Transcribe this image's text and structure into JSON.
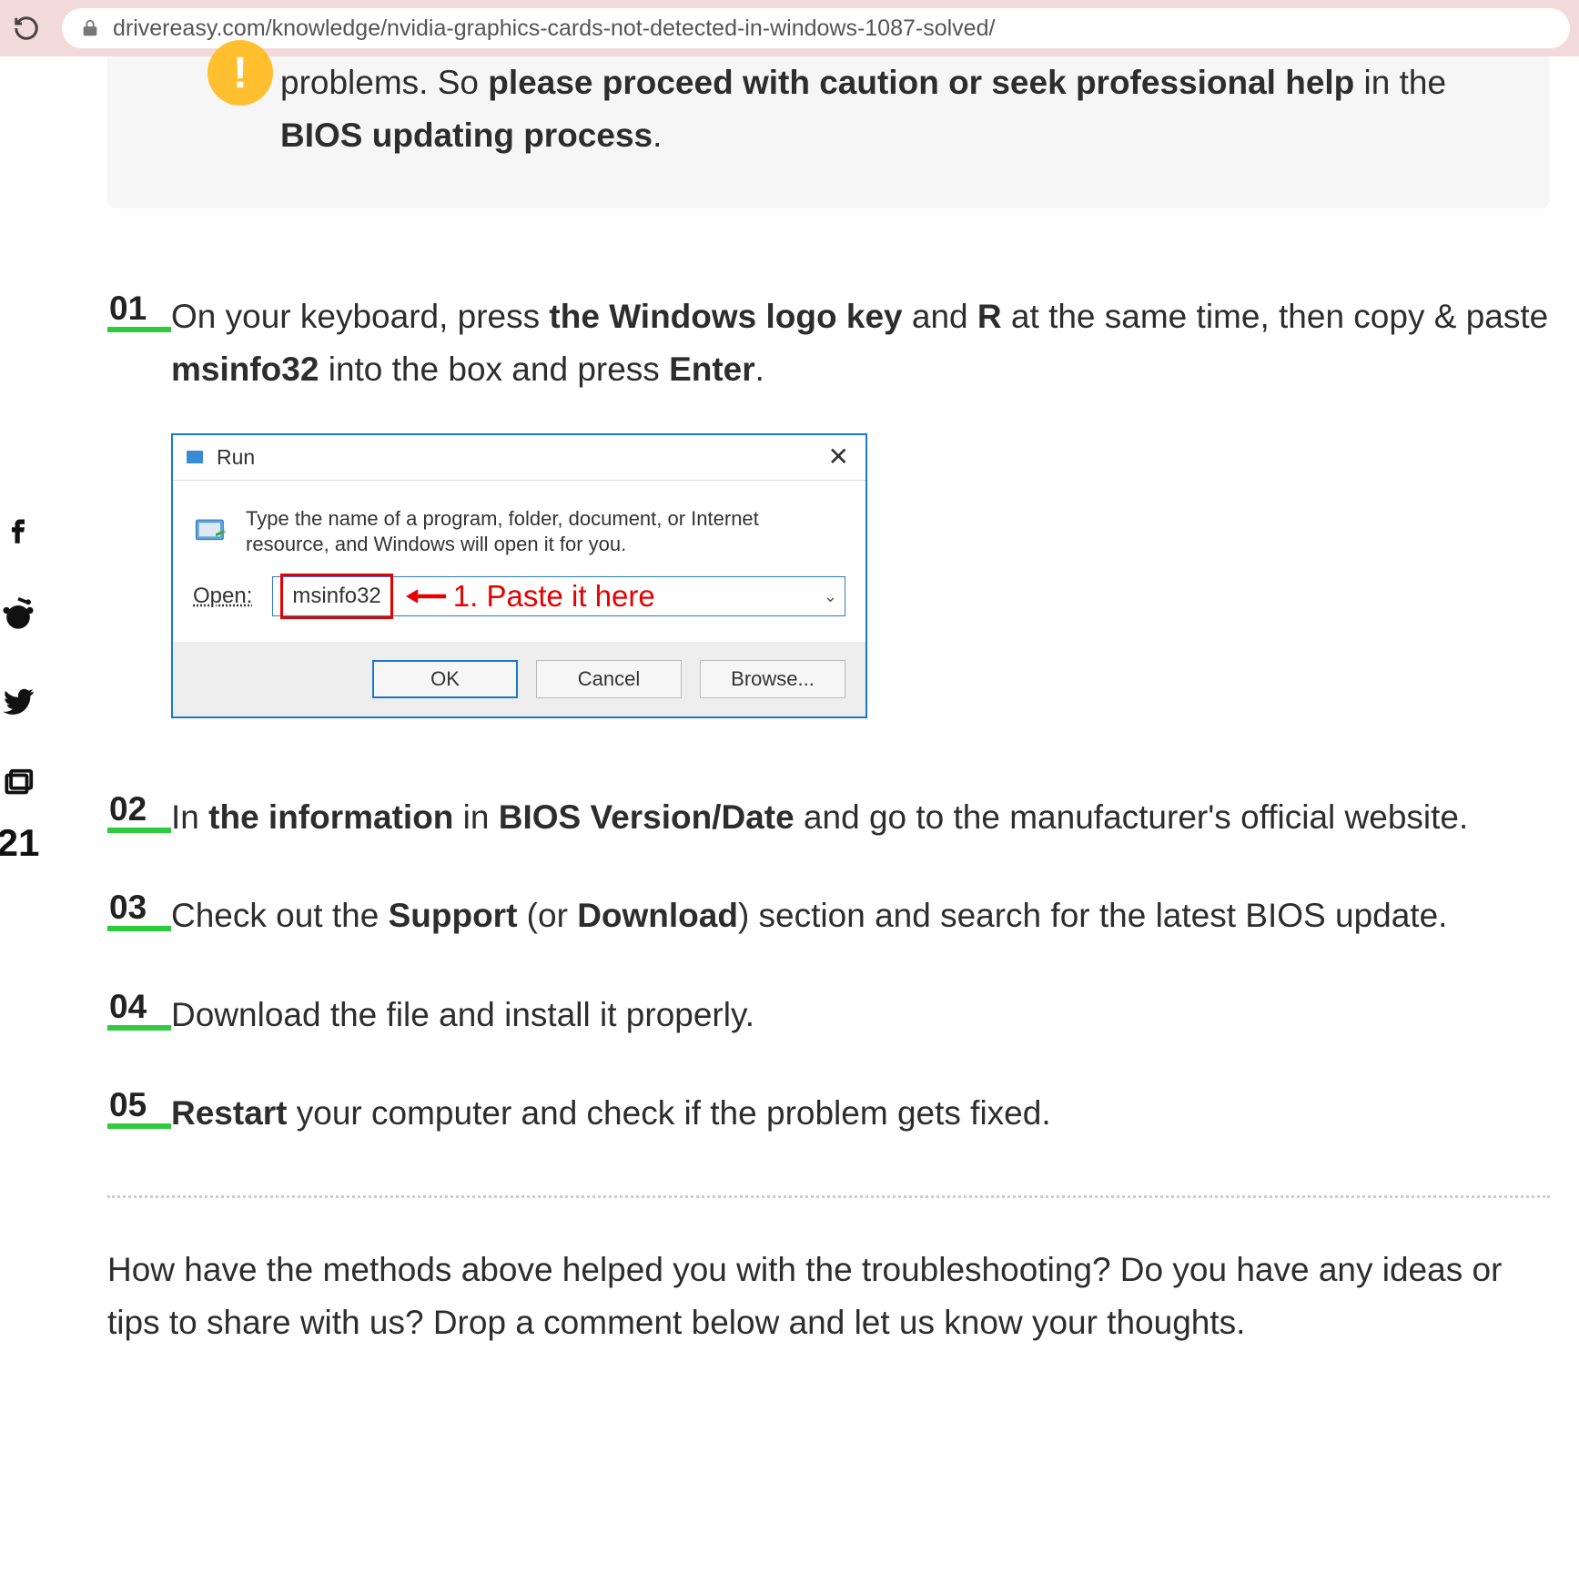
{
  "page_url": "drivereasy.com/knowledge/nvidia-graphics-cards-not-detected-in-windows-1087-solved/",
  "warning": {
    "pre": "problems. So ",
    "bold1": "please proceed with caution or seek professional help",
    "mid": " in the ",
    "bold2": "BIOS updating process",
    "post": "."
  },
  "steps": [
    {
      "num": "01",
      "parts": [
        {
          "t": "On your keyboard, press "
        },
        {
          "t": "the Windows logo key",
          "b": true
        },
        {
          "t": " and "
        },
        {
          "t": "R",
          "b": true
        },
        {
          "t": " at the same time, then copy & paste "
        },
        {
          "t": "msinfo32",
          "b": true
        },
        {
          "t": " into the box and press "
        },
        {
          "t": "Enter",
          "b": true
        },
        {
          "t": "."
        }
      ]
    },
    {
      "num": "02",
      "parts": [
        {
          "t": "In "
        },
        {
          "t": "the information",
          "b": true
        },
        {
          "t": " in "
        },
        {
          "t": "BIOS Version/Date",
          "b": true
        },
        {
          "t": " and go to the manufacturer's official website."
        }
      ]
    },
    {
      "num": "03",
      "parts": [
        {
          "t": "Check out the "
        },
        {
          "t": "Support",
          "b": true
        },
        {
          "t": " (or "
        },
        {
          "t": "Download",
          "b": true
        },
        {
          "t": ") section and search for the latest BIOS update."
        }
      ]
    },
    {
      "num": "04",
      "parts": [
        {
          "t": "Download the file and install it properly."
        }
      ]
    },
    {
      "num": "05",
      "parts": [
        {
          "t": "Restart",
          "b": true
        },
        {
          "t": " your computer and check if the problem gets fixed."
        }
      ]
    }
  ],
  "run_dialog": {
    "title": "Run",
    "desc": "Type the name of a program, folder, document, or Internet resource, and Windows will open it for you.",
    "open_label": "Open:",
    "field_value": "msinfo32",
    "annotation": "1. Paste it here",
    "ok": "OK",
    "cancel": "Cancel",
    "browse": "Browse..."
  },
  "closing": "How have the methods above helped you with the troubleshooting? Do you have any ideas or tips to share with us? Drop a comment below and let us know your thoughts.",
  "social_count": "21"
}
